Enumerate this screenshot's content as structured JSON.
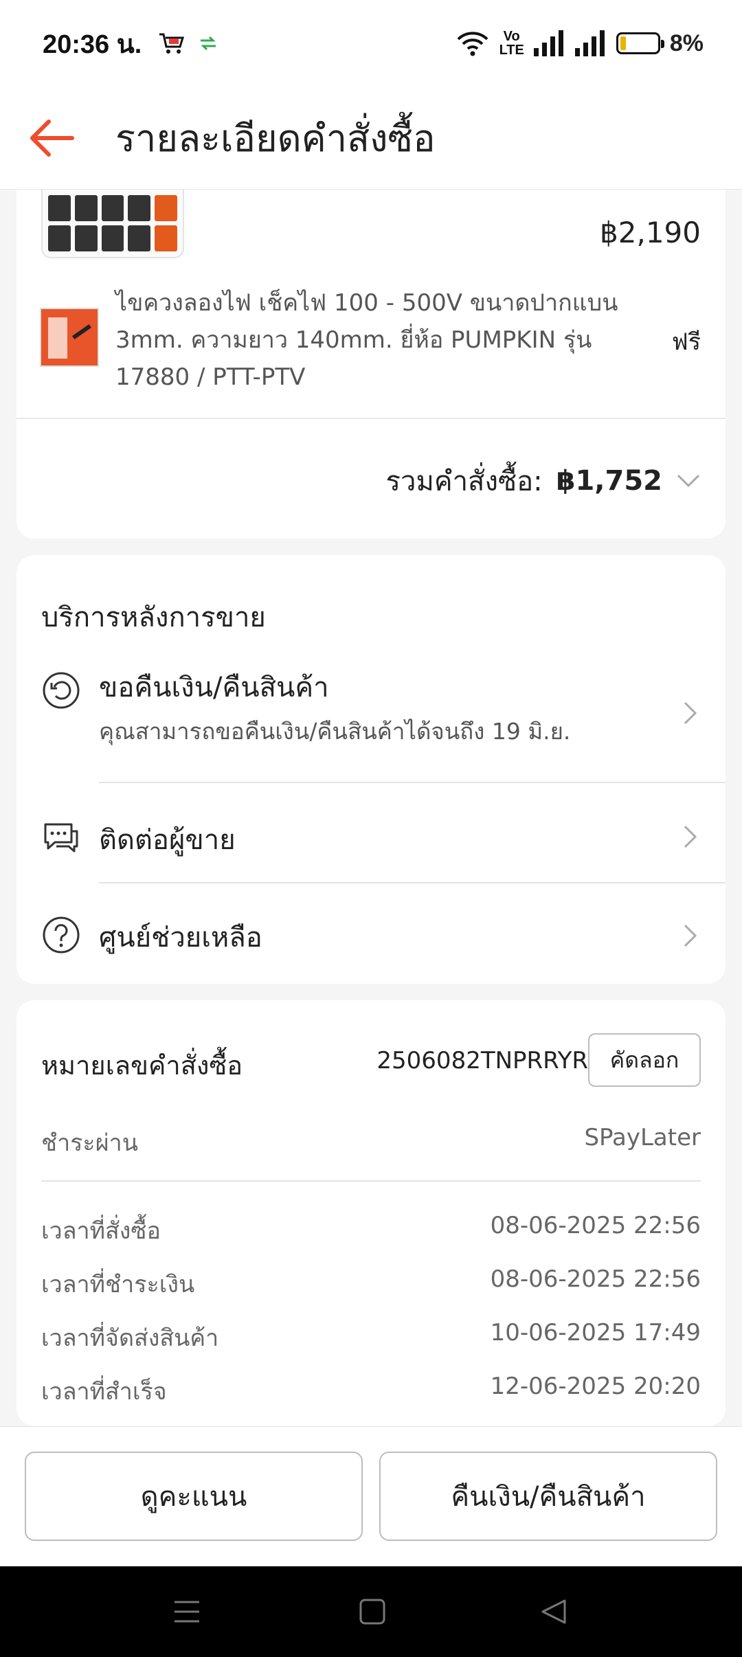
{
  "status_bar": {
    "time": "20:36 น.",
    "volte_top": "Vo",
    "volte_bottom": "LTE",
    "battery": "8%"
  },
  "header": {
    "title": "รายละเอียดคำสั่งซื้อ"
  },
  "order_items": {
    "item1_price": "฿2,190",
    "item2_title": "ไขควงลองไฟ เช็คไฟ 100 - 500V ขนาดปากแบน 3mm. ความยาว 140mm. ยี่ห้อ PUMPKIN รุ่น 17880 / PTT-PTV",
    "item2_price": "ฟรี",
    "total_label": "รวมคำสั่งซื้อ:",
    "total_value": "฿1,752"
  },
  "after_sales": {
    "title": "บริการหลังการขาย",
    "refund_label": "ขอคืนเงิน/คืนสินค้า",
    "refund_sub": "คุณสามารถขอคืนเงิน/คืนสินค้าได้จนถึง 19 มิ.ย.",
    "contact_label": "ติดต่อผู้ขาย",
    "help_label": "ศูนย์ช่วยเหลือ"
  },
  "order_info": {
    "order_no_label": "หมายเลขคำสั่งซื้อ",
    "order_no": "2506082TNPRRYR",
    "copy_label": "คัดลอก",
    "payment_label": "ชำระผ่าน",
    "payment_value": "SPayLater",
    "times": [
      {
        "label": "เวลาที่สั่งซื้อ",
        "value": "08-06-2025 22:56"
      },
      {
        "label": "เวลาที่ชำระเงิน",
        "value": "08-06-2025 22:56"
      },
      {
        "label": "เวลาที่จัดส่งสินค้า",
        "value": "10-06-2025 17:49"
      },
      {
        "label": "เวลาที่สำเร็จ",
        "value": "12-06-2025 20:20"
      }
    ]
  },
  "bottom": {
    "rate_label": "ดูคะแนน",
    "refund_label": "คืนเงิน/คืนสินค้า"
  },
  "colors": {
    "accent": "#ee4d2d"
  }
}
